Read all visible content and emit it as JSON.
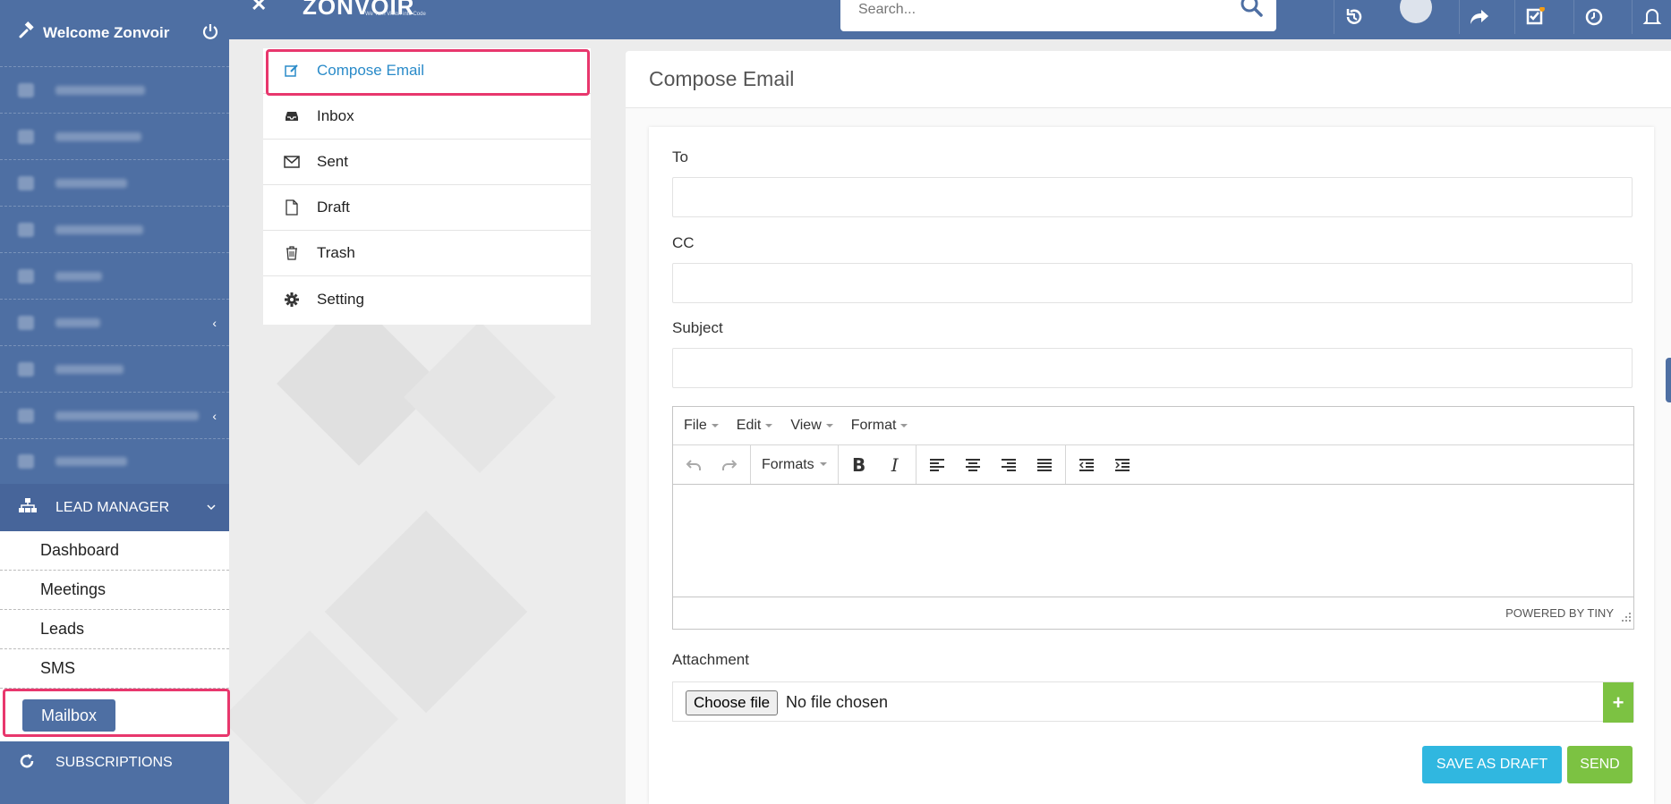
{
  "topbar": {
    "logo": "ZONVOIR",
    "logo_tagline": "We Turn Vision into Code",
    "search_placeholder": "Search..."
  },
  "sidebar": {
    "welcome": "Welcome Zonvoir",
    "lead_manager": "LEAD MANAGER",
    "sub_items": [
      "Dashboard",
      "Meetings",
      "Leads",
      "SMS"
    ],
    "mailbox": "Mailbox",
    "subscriptions": "SUBSCRIPTIONS"
  },
  "mail_nav": {
    "items": [
      "Compose Email",
      "Inbox",
      "Sent",
      "Draft",
      "Trash",
      "Setting"
    ]
  },
  "compose": {
    "title": "Compose Email",
    "to_label": "To",
    "cc_label": "CC",
    "subject_label": "Subject",
    "editor_menu": [
      "File",
      "Edit",
      "View",
      "Format"
    ],
    "formats_label": "Formats",
    "powered_by": "POWERED BY TINY",
    "attachment_label": "Attachment",
    "choose_file": "Choose file",
    "no_file": "No file chosen",
    "save_draft": "SAVE AS DRAFT",
    "send": "SEND"
  },
  "colors": {
    "primary": "#4e6fa3",
    "highlight": "#e8376d",
    "active_link": "#2a8bc9",
    "draft_button": "#30b7e0",
    "send_button": "#7cc242"
  }
}
